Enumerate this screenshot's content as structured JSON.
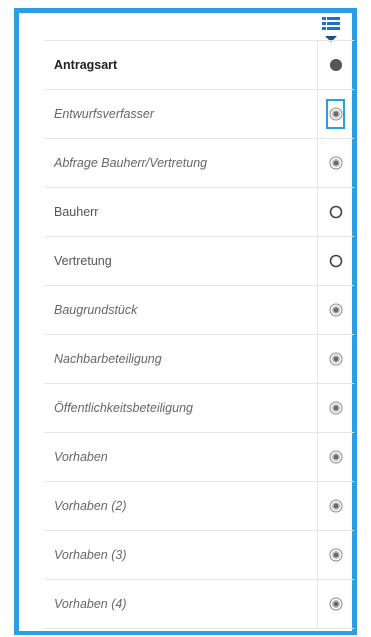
{
  "accent_color": "#2b9fe0",
  "toggle_icon": "list-toggle-icon",
  "items": [
    {
      "label": "Antragsart",
      "style": "bold",
      "status": "filled"
    },
    {
      "label": "Entwurfsverfasser",
      "style": "italic",
      "status": "radio-dot",
      "focused": true
    },
    {
      "label": "Abfrage Bauherr/Vertretung",
      "style": "italic",
      "status": "radio-dot"
    },
    {
      "label": "Bauherr",
      "style": "normal",
      "status": "empty"
    },
    {
      "label": "Vertretung",
      "style": "normal",
      "status": "empty"
    },
    {
      "label": "Baugrundstück",
      "style": "italic",
      "status": "radio-dot"
    },
    {
      "label": "Nachbarbeteiligung",
      "style": "italic",
      "status": "radio-dot"
    },
    {
      "label": "Öffentlichkeitsbeteiligung",
      "style": "italic",
      "status": "radio-dot"
    },
    {
      "label": "Vorhaben",
      "style": "italic",
      "status": "radio-dot"
    },
    {
      "label": "Vorhaben (2)",
      "style": "italic",
      "status": "radio-dot"
    },
    {
      "label": "Vorhaben (3)",
      "style": "italic",
      "status": "radio-dot"
    },
    {
      "label": "Vorhaben (4)",
      "style": "italic",
      "status": "radio-dot"
    }
  ]
}
